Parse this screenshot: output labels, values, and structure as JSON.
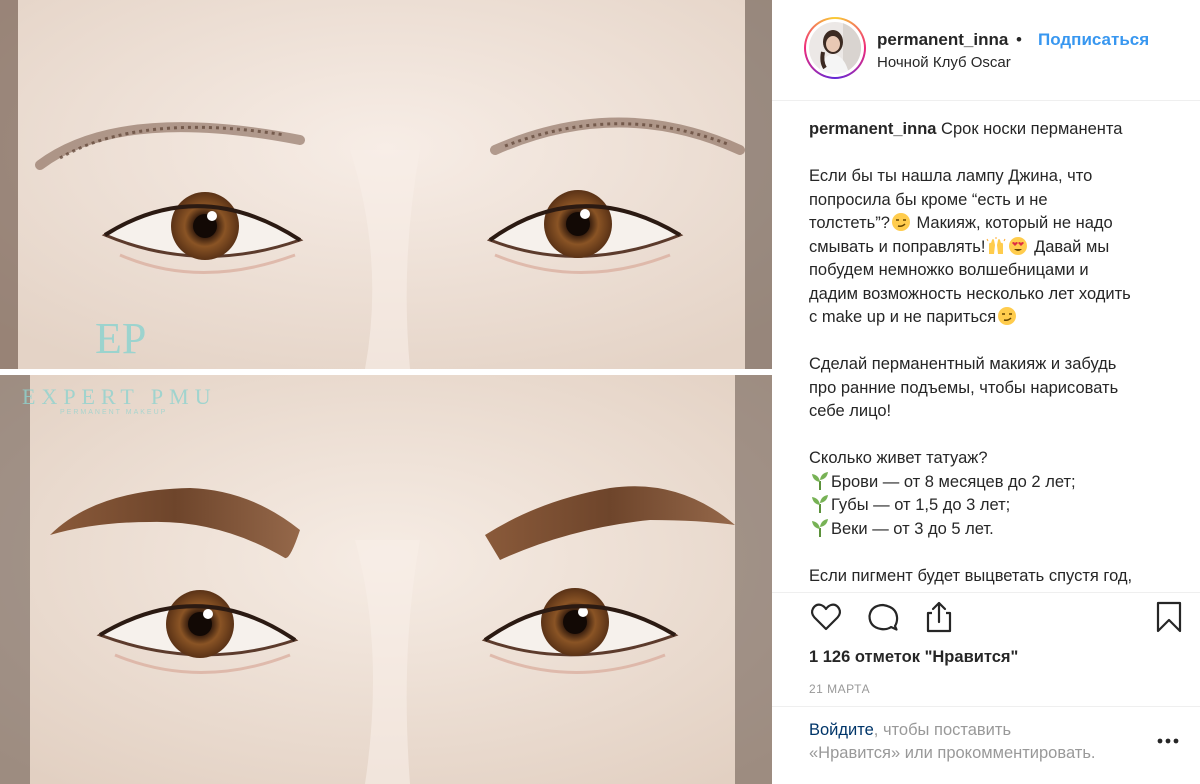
{
  "header": {
    "username": "permanent_inna",
    "separator": "•",
    "follow_label": "Подписаться",
    "location": "Ночной Клуб Oscar"
  },
  "photo": {
    "logo_letters": "EP",
    "watermark": "EXPERT PMU",
    "watermark_sub": "PERMANENT MAKEUP"
  },
  "caption": {
    "username": "permanent_inna",
    "title": "Срок носки перманента",
    "p1": [
      "Если бы ты нашла лампу Джина, что",
      "попросила бы кроме “есть и не",
      "толстеть”?",
      " Макияж, который не надо",
      "смывать и поправлять!",
      " Давай мы",
      "побудем немножко волшебницами и",
      "дадим возможность несколько лет ходить",
      "с make up и не париться"
    ],
    "p2": [
      "Сделай перманентный макияж и забудь",
      "про ранние подъемы, чтобы нарисовать",
      "себе лицо!"
    ],
    "p3_title": "Сколько живет татуаж?",
    "p3": [
      "Брови — от 8 месяцев до 2 лет;",
      "Губы — от 1,5 до 3 лет;",
      "Веки — от 3 до 5 лет."
    ],
    "p4": "Если пигмент будет выцветать спустя год,"
  },
  "likes": "1 126 отметок \"Нравится\"",
  "date": "21 МАРТА",
  "login": {
    "link": "Войдите",
    "text1": ", чтобы поставить",
    "text2": "«Нравится» или прокомментировать."
  },
  "colors": {
    "accent": "#3897f0",
    "link": "#003569",
    "muted": "#999999",
    "text": "#262626"
  },
  "icons": {
    "like": "heart-icon",
    "comment": "comment-icon",
    "share": "share-icon",
    "save": "bookmark-icon",
    "more": "more-options-icon"
  }
}
